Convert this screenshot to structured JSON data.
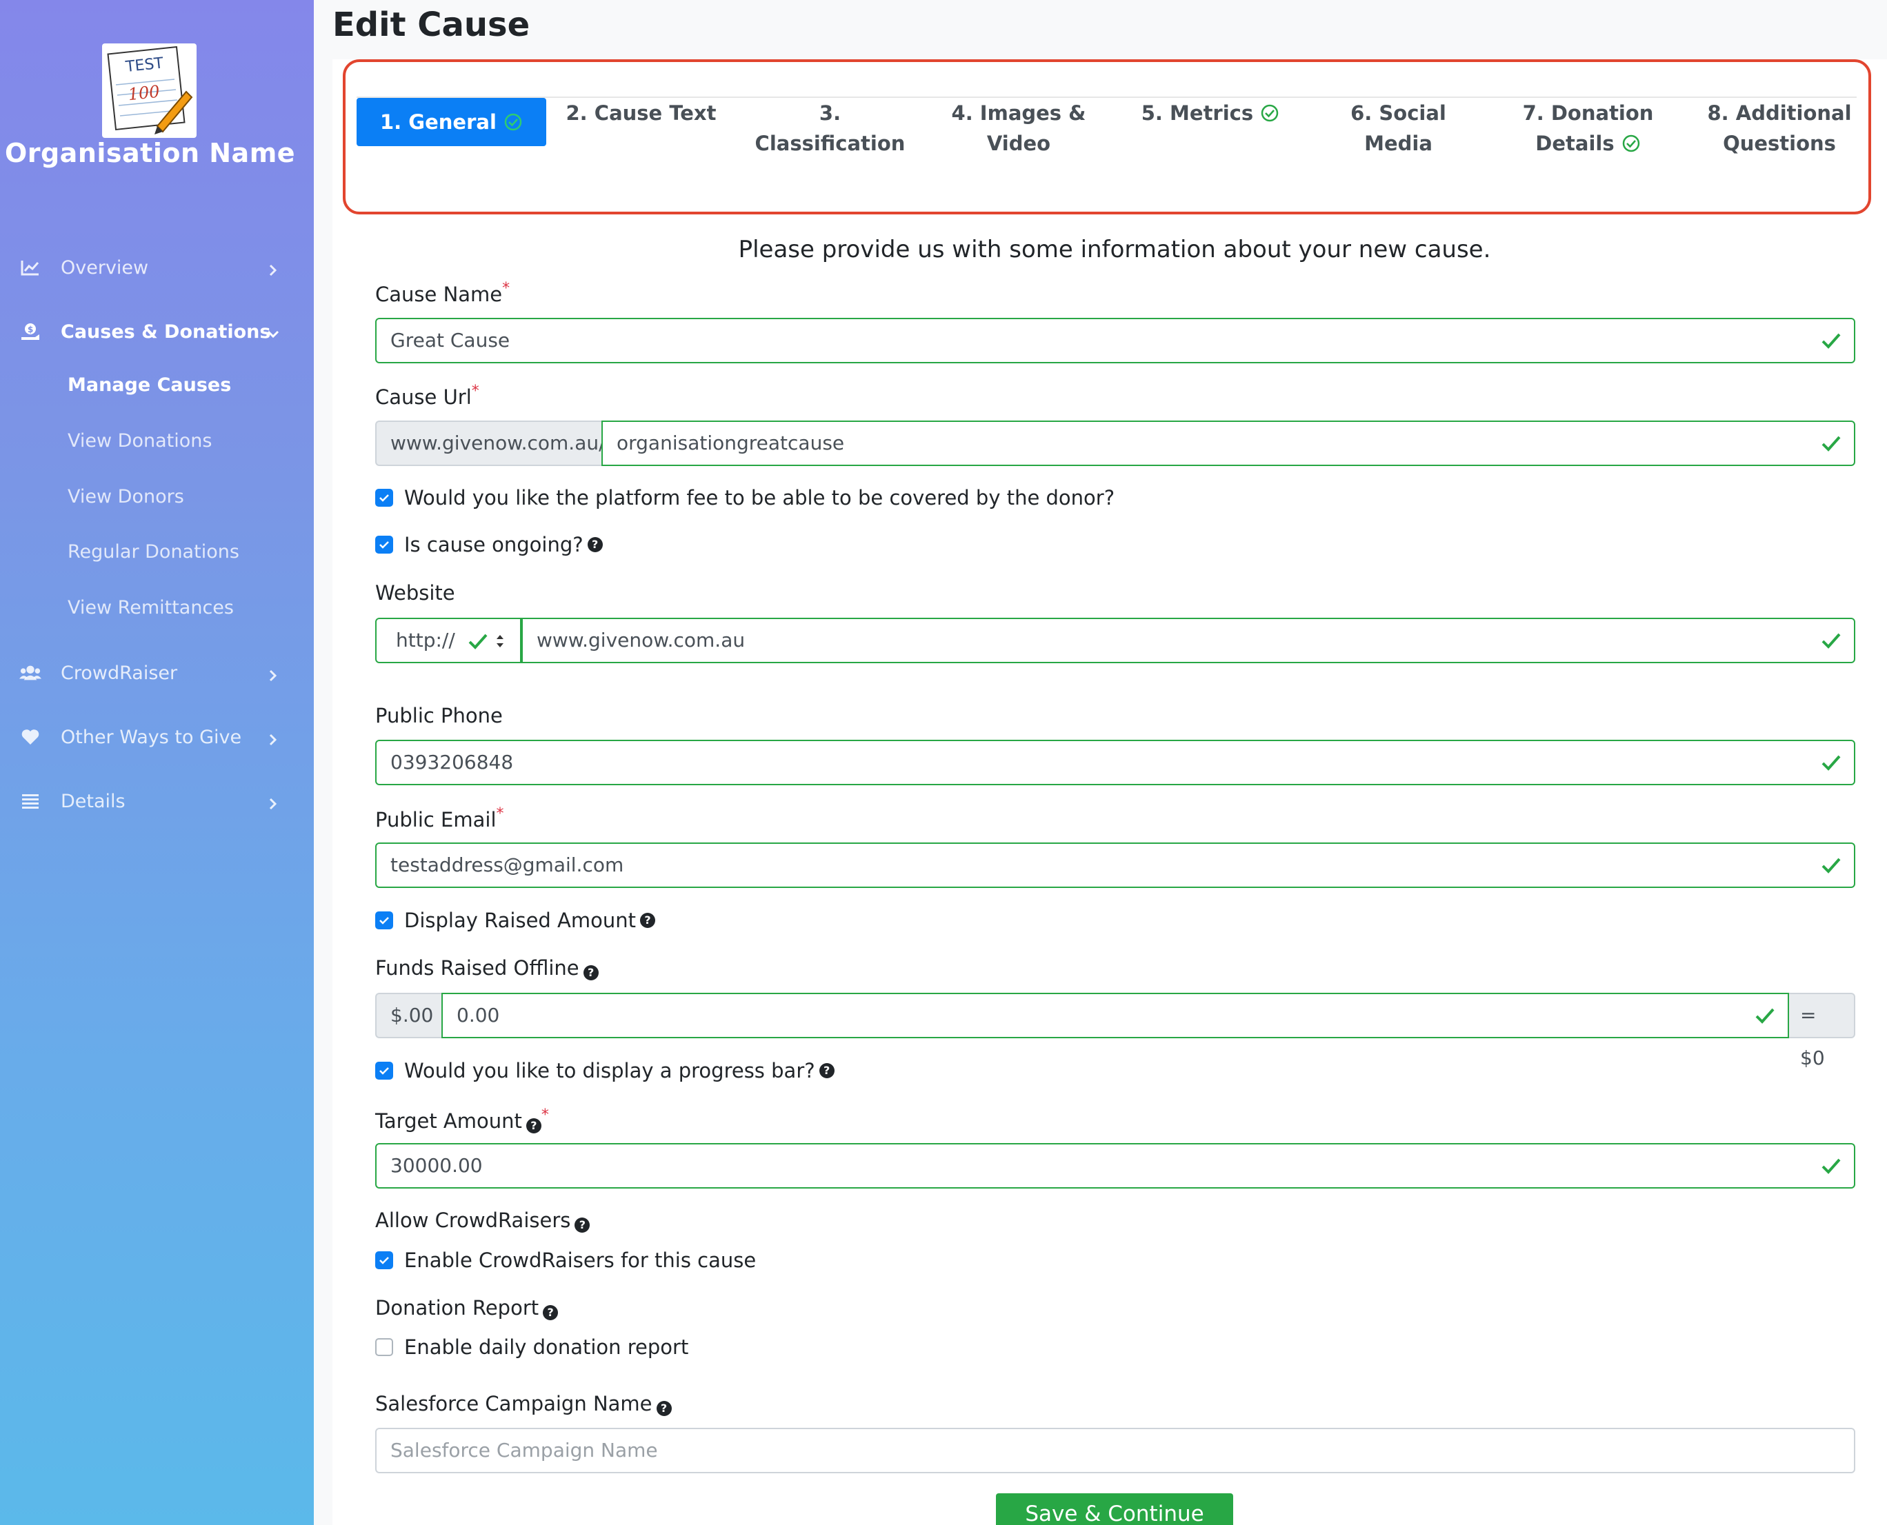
{
  "sidebar": {
    "org_name": "Organisation Name",
    "logo_text": "TEST",
    "logo_score": "100",
    "nav": [
      {
        "label": "Overview",
        "icon": "chart-line-icon"
      },
      {
        "label": "Causes & Donations",
        "icon": "hand-dollar-icon"
      },
      {
        "label": "CrowdRaiser",
        "icon": "users-icon"
      },
      {
        "label": "Other Ways to Give",
        "icon": "heart-icon"
      },
      {
        "label": "Details",
        "icon": "list-icon"
      }
    ],
    "sub_items": [
      "Manage Causes",
      "View Donations",
      "View Donors",
      "Regular Donations",
      "View Remittances"
    ]
  },
  "page": {
    "title": "Edit Cause"
  },
  "wizard": {
    "steps": [
      {
        "line1": "1. General",
        "line2": "",
        "complete": true
      },
      {
        "line1": "2. Cause Text",
        "line2": "",
        "complete": false
      },
      {
        "line1": "3. Classification",
        "line2": "",
        "complete": false
      },
      {
        "line1": "4. Images &",
        "line2": "Video",
        "complete": false
      },
      {
        "line1": "5. Metrics",
        "line2": "",
        "complete": true
      },
      {
        "line1": "6. Social Media",
        "line2": "",
        "complete": false
      },
      {
        "line1": "7. Donation",
        "line2": "Details",
        "complete": true
      },
      {
        "line1": "8. Additional",
        "line2": "Questions",
        "complete": false
      }
    ],
    "active_step": "1. General"
  },
  "form": {
    "intro": "Please provide us with some information about your new cause.",
    "cause_name_label": "Cause Name",
    "cause_name_value": "Great Cause",
    "cause_url_label": "Cause Url",
    "cause_url_prefix": "www.givenow.com.au/",
    "cause_url_value": "organisationgreatcause",
    "platform_fee_label": "Would you like the platform fee to be able to be covered by the donor?",
    "ongoing_label": "Is cause ongoing?",
    "website_label": "Website",
    "website_protocol": "http://",
    "website_value": "www.givenow.com.au",
    "phone_label": "Public Phone",
    "phone_value": "0393206848",
    "email_label": "Public Email",
    "email_value": "testaddress@gmail.com",
    "display_raised_label": "Display Raised Amount",
    "funds_offline_label": "Funds Raised Offline",
    "funds_prefix": "$.00",
    "funds_value": "0.00",
    "funds_suffix": "= $0",
    "progress_bar_label": "Would you like to display a progress bar?",
    "target_label": "Target Amount",
    "target_value": "30000.00",
    "allow_crowdraisers_label": "Allow CrowdRaisers",
    "enable_crowdraisers_label": "Enable CrowdRaisers for this cause",
    "donation_report_label": "Donation Report",
    "daily_report_label": "Enable daily donation report",
    "salesforce_label": "Salesforce Campaign Name",
    "salesforce_placeholder": "Salesforce Campaign Name",
    "save_label": "Save & Continue"
  },
  "colors": {
    "accent": "#0b7ff5",
    "valid": "#28a745",
    "highlight": "#e2452f"
  }
}
